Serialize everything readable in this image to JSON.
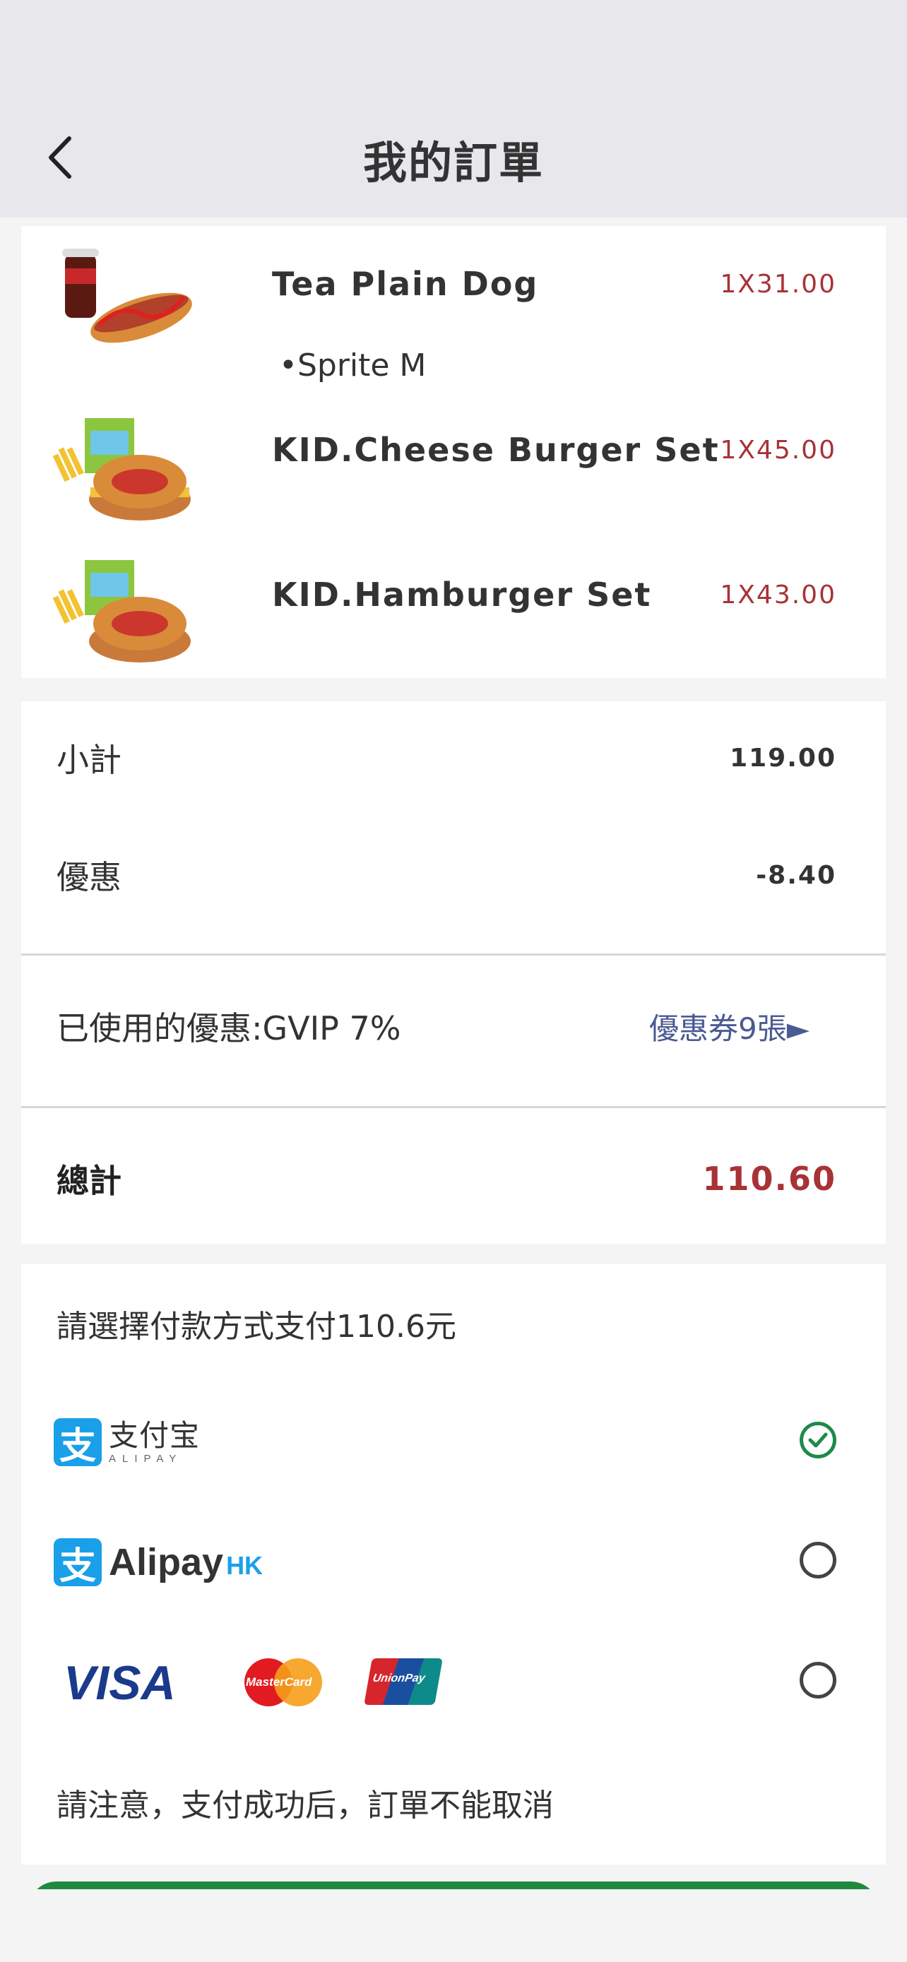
{
  "header": {
    "title": "我的訂單",
    "back_icon": "chevron-left-icon"
  },
  "items": [
    {
      "name": "Tea Plain Dog",
      "price": "1X31.00",
      "sub": "•Sprite M",
      "image": "hotdog-with-coke"
    },
    {
      "name": "KID.Cheese Burger Set",
      "price": "1X45.00",
      "image": "cheese-burger-kids-set"
    },
    {
      "name": "KID.Hamburger Set",
      "price": "1X43.00",
      "image": "hamburger-kids-set"
    }
  ],
  "summary": {
    "subtotal_label": "小計",
    "subtotal_value": "119.00",
    "discount_label": "優惠",
    "discount_value": "-8.40",
    "coupon_used": "已使用的優惠:GVIP 7%",
    "coupon_link": "優惠券9張►",
    "total_label": "總計",
    "total_value": "110.60"
  },
  "payment": {
    "prompt": "請選擇付款方式支付110.6元",
    "methods": [
      {
        "name": "alipay",
        "logo_text": "支付宝",
        "logo_sub": "ALIPAY",
        "selected": true
      },
      {
        "name": "alipay-hk",
        "logo_text": "Alipay",
        "logo_sub": "HK",
        "selected": false
      },
      {
        "name": "cards",
        "visa": "VISA",
        "mastercard": "MasterCard",
        "unionpay": "UnionPay",
        "selected": false
      }
    ],
    "note": "請注意，支付成功后，訂單不能取消"
  },
  "colors": {
    "accent_red": "#a83236",
    "link_blue": "#4a5a92",
    "check_green": "#1e8a4a",
    "alipay_blue": "#1aa0e8"
  }
}
